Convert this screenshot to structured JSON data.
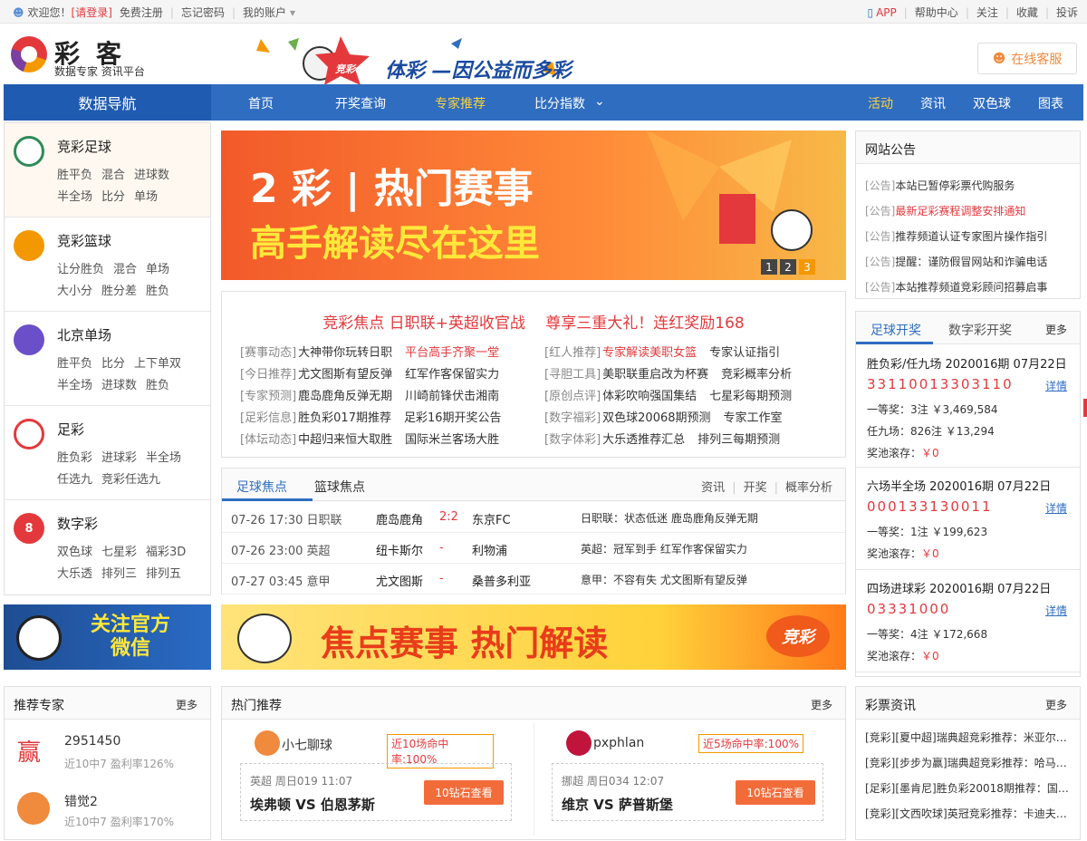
{
  "topbar": {
    "welcome": "欢迎您！",
    "login": "[请登录]",
    "register": "免费注册",
    "forgot": "忘记密码",
    "account": "我的账户",
    "app": "APP",
    "help": "帮助中心",
    "follow": "关注",
    "fav": "收藏",
    "complain": "投诉"
  },
  "header": {
    "logo": "彩客",
    "logo_sub": "数据专家 资讯平台",
    "slogan": "体彩 —因公益而多彩",
    "slogan_badge": "竞彩",
    "service": "在线客服"
  },
  "nav": {
    "title": "数据导航",
    "items": [
      "首页",
      "开奖查询",
      "专家推荐",
      "比分指数"
    ],
    "right": [
      "活动",
      "资讯",
      "双色球",
      "图表"
    ]
  },
  "sidebar": [
    {
      "title": "竞彩足球",
      "links": [
        "胜平负",
        "混合",
        "进球数",
        "半全场",
        "比分",
        "单场"
      ],
      "color": "#2e8b57"
    },
    {
      "title": "竞彩篮球",
      "links": [
        "让分胜负",
        "混合",
        "单场",
        "大小分",
        "胜分差",
        "胜负"
      ],
      "color": "#f39800"
    },
    {
      "title": "北京单场",
      "links": [
        "胜平负",
        "比分",
        "上下单双",
        "半全场",
        "进球数",
        "胜负"
      ],
      "color": "#6a4fc8"
    },
    {
      "title": "足彩",
      "links": [
        "胜负彩",
        "进球彩",
        "半全场",
        "任选九",
        "竞彩任选九"
      ],
      "color": "#e4393c"
    },
    {
      "title": "数字彩",
      "links": [
        "双色球",
        "七星彩",
        "福彩3D",
        "大乐透",
        "排列三",
        "排列五"
      ],
      "color": "#e4393c"
    }
  ],
  "banner": {
    "line1": "2 彩 | 热门赛事",
    "line2": "高手解读尽在这里",
    "pages": [
      "1",
      "2",
      "3"
    ]
  },
  "news": {
    "headline": "竞彩焦点 日职联+英超收官战　 尊享三重大礼！连红奖励168",
    "rows": [
      [
        {
          "tag": "[赛事动态]",
          "a": "大神带你玩转日职",
          "b": "平台高手齐聚一堂",
          "b_red": true
        },
        {
          "tag": "[红人推荐]",
          "a": "专家解读美职女篮",
          "a_red": true,
          "b": "专家认证指引"
        }
      ],
      [
        {
          "tag": "[今日推荐]",
          "a": "尤文图斯有望反弹",
          "b": "红军作客保留实力"
        },
        {
          "tag": "[寻胆工具]",
          "a": "美职联重启改为杯赛",
          "b": "竞彩概率分析"
        }
      ],
      [
        {
          "tag": "[专家预测]",
          "a": "鹿岛鹿角反弹无期",
          "b": "川崎前锋伏击湘南"
        },
        {
          "tag": "[原创点评]",
          "a": "体彩吹响强国集结",
          "b": "七星彩每期预测"
        }
      ],
      [
        {
          "tag": "[足彩信息]",
          "a": "胜负彩017期推荐",
          "b": "足彩16期开奖公告"
        },
        {
          "tag": "[数字福彩]",
          "a": "双色球20068期预测",
          "b": "专家工作室"
        }
      ],
      [
        {
          "tag": "[体坛动态]",
          "a": "中超归来恒大取胜",
          "b": "国际米兰客场大胜"
        },
        {
          "tag": "[数字体彩]",
          "a": "大乐透推荐汇总",
          "b": "排列三每期预测"
        }
      ]
    ]
  },
  "focus": {
    "tabs": [
      "足球焦点",
      "篮球焦点"
    ],
    "links": [
      "资讯",
      "开奖",
      "概率分析"
    ],
    "matches": [
      {
        "time": "07-26 17:30 日职联",
        "home": "鹿岛鹿角",
        "score": "2:2",
        "away": "东京FC",
        "note": "日职联：状态低迷 鹿岛鹿角反弹无期"
      },
      {
        "time": "07-26 23:00 英超",
        "home": "纽卡斯尔",
        "score": "-",
        "away": "利物浦",
        "note": "英超：冠军到手 红军作客保留实力"
      },
      {
        "time": "07-27 03:45 意甲",
        "home": "尤文图斯",
        "score": "-",
        "away": "桑普多利亚",
        "note": "意甲：不容有失 尤文图斯有望反弹"
      }
    ]
  },
  "ads": {
    "wx": "关注官方微信",
    "focus": "焦点赛事 热门解读",
    "focus_badge": "竞彩"
  },
  "notice": {
    "title": "网站公告",
    "items": [
      {
        "tag": "[公告]",
        "text": "本站已暂停彩票代购服务",
        "red": false
      },
      {
        "tag": "[公告]",
        "text": "最新足彩赛程调整安排通知",
        "red": true
      },
      {
        "tag": "[公告]",
        "text": "推荐频道认证专家图片操作指引",
        "red": false
      },
      {
        "tag": "[公告]",
        "text": "提醒：谨防假冒网站和诈骗电话",
        "red": false
      },
      {
        "tag": "[公告]",
        "text": "本站推荐频道竞彩顾问招募启事",
        "red": false
      }
    ]
  },
  "draw": {
    "tabs": [
      "足球开奖",
      "数字彩开奖"
    ],
    "more": "更多",
    "detail": "详情",
    "blocks": [
      {
        "name": "胜负彩/任九场 2020016期 07月22日",
        "num": "33110013303110",
        "l1": "一等奖：3注 ￥3,469,584",
        "l2": "任九场：826注 ￥13,294",
        "l3": "奖池滚存：",
        "l3v": "￥0"
      },
      {
        "name": "六场半全场 2020016期 07月22日",
        "num": "000133130011",
        "l1": "一等奖：1注 ￥199,623",
        "l2": "",
        "l3": "奖池滚存：",
        "l3v": "￥0"
      },
      {
        "name": "四场进球彩 2020016期 07月22日",
        "num": "03331000",
        "l1": "一等奖：4注 ￥172,668",
        "l2": "",
        "l3": "奖池滚存：",
        "l3v": "￥0"
      }
    ]
  },
  "expert": {
    "title": "推荐专家",
    "more": "更多",
    "items": [
      {
        "name": "2951450",
        "stat": "近10中7  盈利率126%",
        "avatar": "赢"
      },
      {
        "name": "错觉2",
        "stat": "近10中7  盈利率170%",
        "avatar": ""
      }
    ]
  },
  "hot": {
    "title": "热门推荐",
    "more": "更多",
    "items": [
      {
        "name": "小七聊球",
        "rate": "近10场命中率:100%",
        "league": "英超 周日019 11:07",
        "vs": "埃弗顿 VS 伯恩茅斯",
        "btn": "10钻石查看"
      },
      {
        "name": "pxphlan",
        "rate": "近5场命中率:100%",
        "league": "挪超 周日034 12:07",
        "vs": "维京 VS 萨普斯堡",
        "btn": "10钻石查看"
      }
    ]
  },
  "lottery": {
    "title": "彩票资讯",
    "more": "更多",
    "items": [
      "[竞彩][夏中超]瑞典超竞彩推荐：米亚尔…",
      "[竞彩][步步为赢]瑞典超竞彩推荐：哈马…",
      "[足彩][墨肯尼]胜负彩20018期推荐：国…",
      "[竞彩][文西吹球]英冠竞彩推荐：卡迪夫…"
    ]
  },
  "colors": {
    "nav": "#2f6dc0",
    "accent": "#e4393c",
    "orange": "#f39800"
  }
}
